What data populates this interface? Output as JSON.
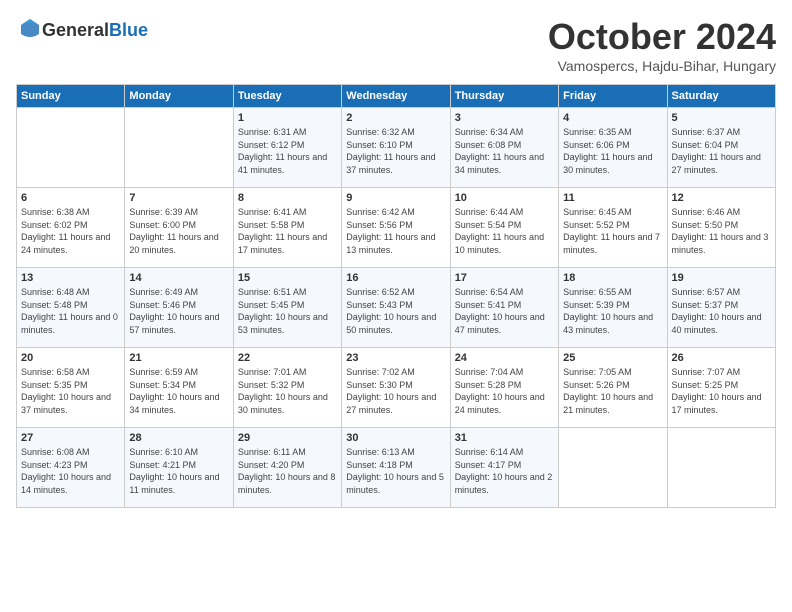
{
  "header": {
    "logo_general": "General",
    "logo_blue": "Blue",
    "month_title": "October 2024",
    "location": "Vamospercs, Hajdu-Bihar, Hungary"
  },
  "weekdays": [
    "Sunday",
    "Monday",
    "Tuesday",
    "Wednesday",
    "Thursday",
    "Friday",
    "Saturday"
  ],
  "weeks": [
    [
      {
        "day": "",
        "info": ""
      },
      {
        "day": "",
        "info": ""
      },
      {
        "day": "1",
        "info": "Sunrise: 6:31 AM\nSunset: 6:12 PM\nDaylight: 11 hours and 41 minutes."
      },
      {
        "day": "2",
        "info": "Sunrise: 6:32 AM\nSunset: 6:10 PM\nDaylight: 11 hours and 37 minutes."
      },
      {
        "day": "3",
        "info": "Sunrise: 6:34 AM\nSunset: 6:08 PM\nDaylight: 11 hours and 34 minutes."
      },
      {
        "day": "4",
        "info": "Sunrise: 6:35 AM\nSunset: 6:06 PM\nDaylight: 11 hours and 30 minutes."
      },
      {
        "day": "5",
        "info": "Sunrise: 6:37 AM\nSunset: 6:04 PM\nDaylight: 11 hours and 27 minutes."
      }
    ],
    [
      {
        "day": "6",
        "info": "Sunrise: 6:38 AM\nSunset: 6:02 PM\nDaylight: 11 hours and 24 minutes."
      },
      {
        "day": "7",
        "info": "Sunrise: 6:39 AM\nSunset: 6:00 PM\nDaylight: 11 hours and 20 minutes."
      },
      {
        "day": "8",
        "info": "Sunrise: 6:41 AM\nSunset: 5:58 PM\nDaylight: 11 hours and 17 minutes."
      },
      {
        "day": "9",
        "info": "Sunrise: 6:42 AM\nSunset: 5:56 PM\nDaylight: 11 hours and 13 minutes."
      },
      {
        "day": "10",
        "info": "Sunrise: 6:44 AM\nSunset: 5:54 PM\nDaylight: 11 hours and 10 minutes."
      },
      {
        "day": "11",
        "info": "Sunrise: 6:45 AM\nSunset: 5:52 PM\nDaylight: 11 hours and 7 minutes."
      },
      {
        "day": "12",
        "info": "Sunrise: 6:46 AM\nSunset: 5:50 PM\nDaylight: 11 hours and 3 minutes."
      }
    ],
    [
      {
        "day": "13",
        "info": "Sunrise: 6:48 AM\nSunset: 5:48 PM\nDaylight: 11 hours and 0 minutes."
      },
      {
        "day": "14",
        "info": "Sunrise: 6:49 AM\nSunset: 5:46 PM\nDaylight: 10 hours and 57 minutes."
      },
      {
        "day": "15",
        "info": "Sunrise: 6:51 AM\nSunset: 5:45 PM\nDaylight: 10 hours and 53 minutes."
      },
      {
        "day": "16",
        "info": "Sunrise: 6:52 AM\nSunset: 5:43 PM\nDaylight: 10 hours and 50 minutes."
      },
      {
        "day": "17",
        "info": "Sunrise: 6:54 AM\nSunset: 5:41 PM\nDaylight: 10 hours and 47 minutes."
      },
      {
        "day": "18",
        "info": "Sunrise: 6:55 AM\nSunset: 5:39 PM\nDaylight: 10 hours and 43 minutes."
      },
      {
        "day": "19",
        "info": "Sunrise: 6:57 AM\nSunset: 5:37 PM\nDaylight: 10 hours and 40 minutes."
      }
    ],
    [
      {
        "day": "20",
        "info": "Sunrise: 6:58 AM\nSunset: 5:35 PM\nDaylight: 10 hours and 37 minutes."
      },
      {
        "day": "21",
        "info": "Sunrise: 6:59 AM\nSunset: 5:34 PM\nDaylight: 10 hours and 34 minutes."
      },
      {
        "day": "22",
        "info": "Sunrise: 7:01 AM\nSunset: 5:32 PM\nDaylight: 10 hours and 30 minutes."
      },
      {
        "day": "23",
        "info": "Sunrise: 7:02 AM\nSunset: 5:30 PM\nDaylight: 10 hours and 27 minutes."
      },
      {
        "day": "24",
        "info": "Sunrise: 7:04 AM\nSunset: 5:28 PM\nDaylight: 10 hours and 24 minutes."
      },
      {
        "day": "25",
        "info": "Sunrise: 7:05 AM\nSunset: 5:26 PM\nDaylight: 10 hours and 21 minutes."
      },
      {
        "day": "26",
        "info": "Sunrise: 7:07 AM\nSunset: 5:25 PM\nDaylight: 10 hours and 17 minutes."
      }
    ],
    [
      {
        "day": "27",
        "info": "Sunrise: 6:08 AM\nSunset: 4:23 PM\nDaylight: 10 hours and 14 minutes."
      },
      {
        "day": "28",
        "info": "Sunrise: 6:10 AM\nSunset: 4:21 PM\nDaylight: 10 hours and 11 minutes."
      },
      {
        "day": "29",
        "info": "Sunrise: 6:11 AM\nSunset: 4:20 PM\nDaylight: 10 hours and 8 minutes."
      },
      {
        "day": "30",
        "info": "Sunrise: 6:13 AM\nSunset: 4:18 PM\nDaylight: 10 hours and 5 minutes."
      },
      {
        "day": "31",
        "info": "Sunrise: 6:14 AM\nSunset: 4:17 PM\nDaylight: 10 hours and 2 minutes."
      },
      {
        "day": "",
        "info": ""
      },
      {
        "day": "",
        "info": ""
      }
    ]
  ]
}
